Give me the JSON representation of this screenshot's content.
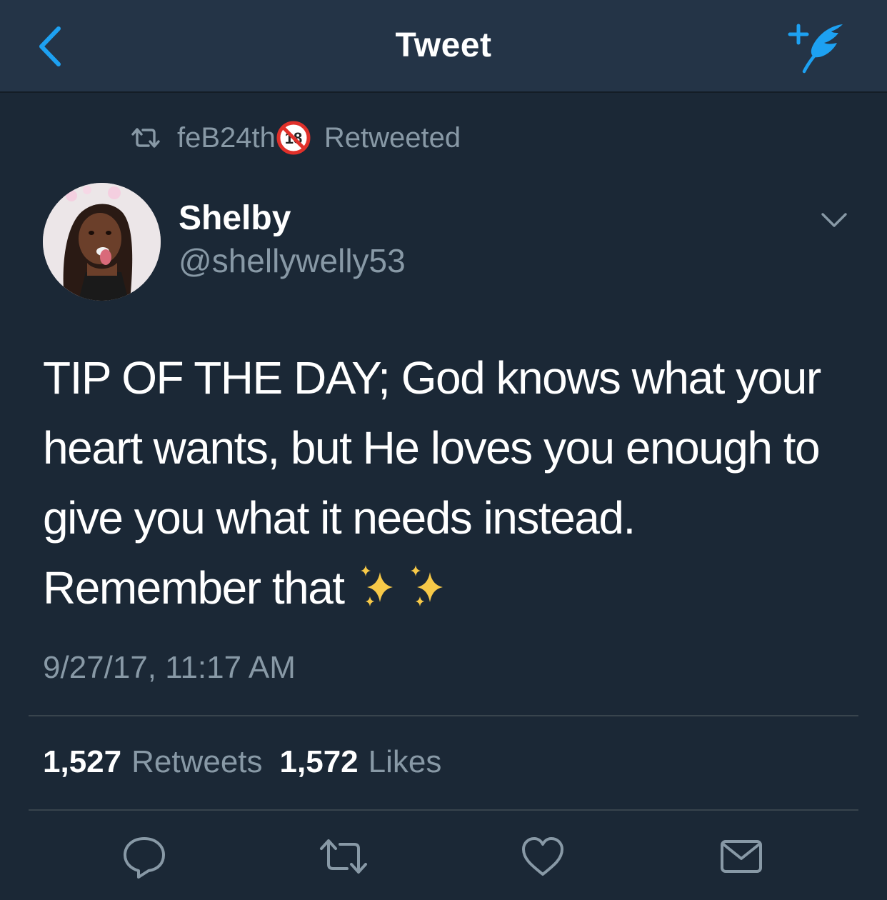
{
  "nav": {
    "title": "Tweet",
    "back_icon": "chevron-left-icon",
    "compose_icon": "compose-tweet-icon",
    "accent_color": "#1da1f2"
  },
  "retweet_context": {
    "user": "feB24th",
    "badge_icon": "no-under-18-icon",
    "badge_text": "18",
    "label": "Retweeted"
  },
  "author": {
    "display_name": "Shelby",
    "handle": "@shellywelly53"
  },
  "tweet": {
    "lines": [
      "TIP OF THE DAY; God knows what your",
      "heart wants, but He loves you enough to",
      "give you what it needs instead.",
      "Remember that"
    ],
    "trailing_emoji": "sparkles-icon",
    "timestamp": "9/27/17, 11:17 AM"
  },
  "stats": {
    "retweets_count": "1,527",
    "retweets_label": "Retweets",
    "likes_count": "1,572",
    "likes_label": "Likes"
  },
  "actions": [
    "reply-icon",
    "retweet-icon",
    "like-icon",
    "direct-message-icon"
  ],
  "colors": {
    "background": "#1b2836",
    "navbar": "#243447",
    "secondary_text": "#8899a6",
    "divider": "#38444d"
  }
}
